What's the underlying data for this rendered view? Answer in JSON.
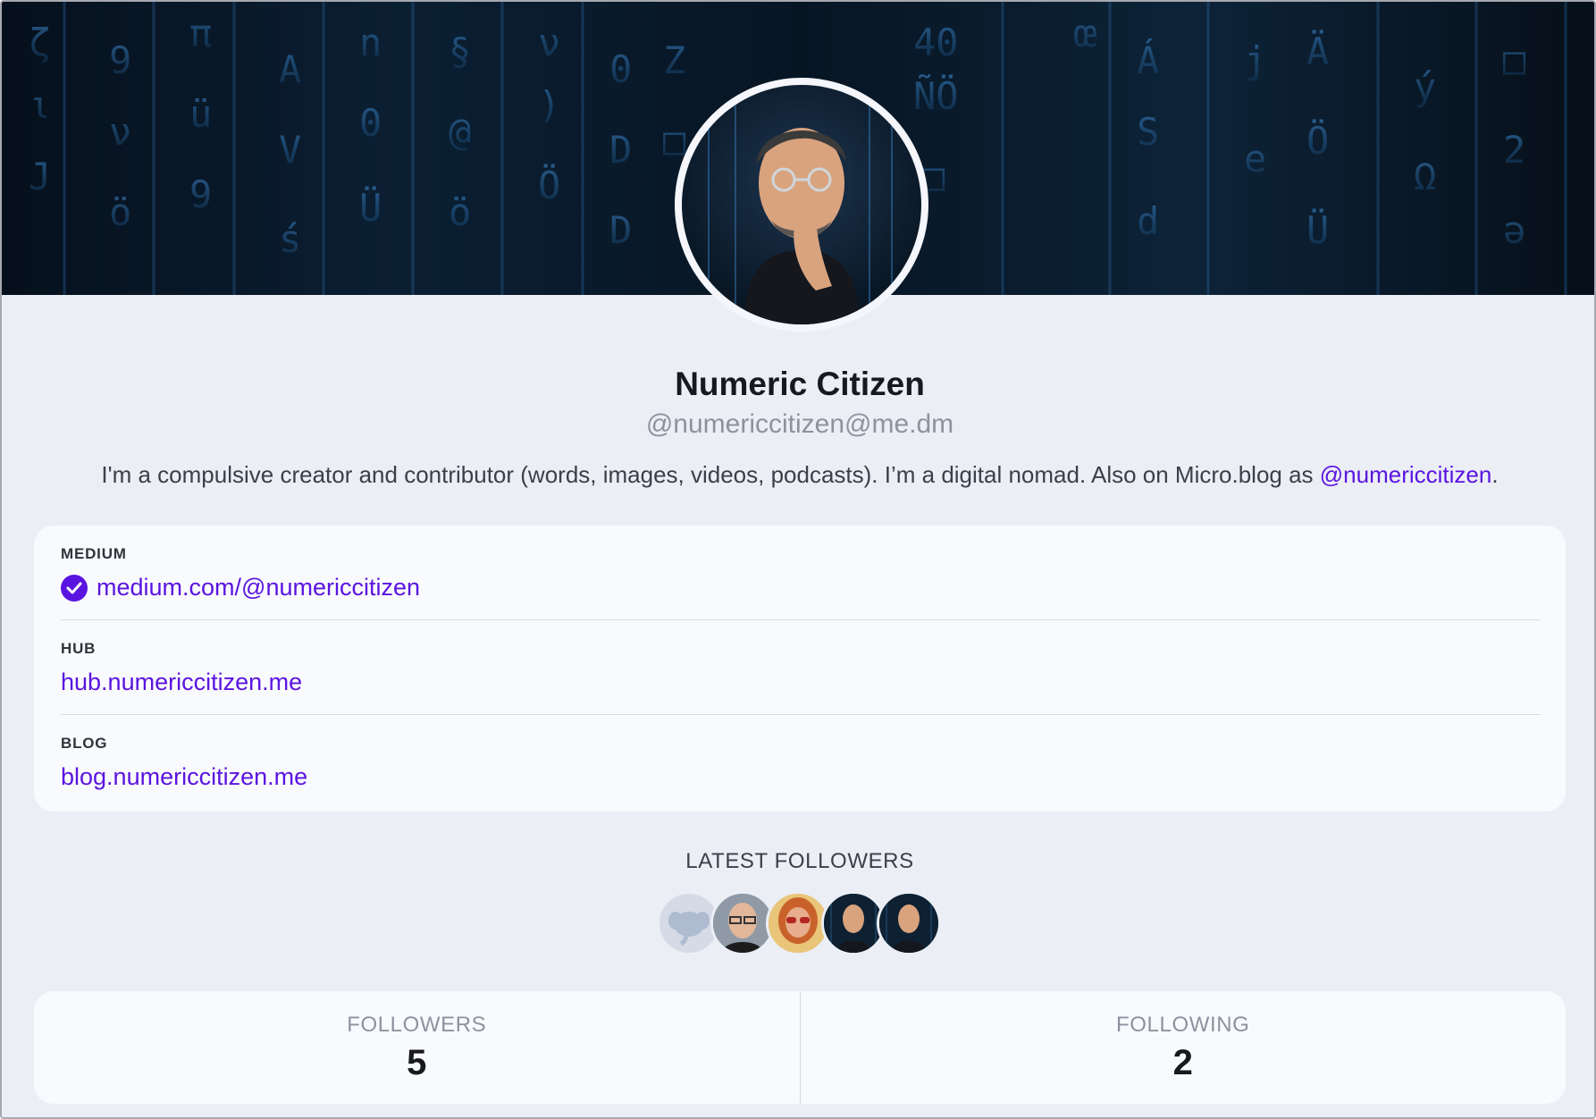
{
  "profile": {
    "display_name": "Numeric Citizen",
    "handle": "@numericcitizen@me.dm",
    "bio_text": "I'm a compulsive creator and contributor (words, images, videos, podcasts). I’m a digital nomad. Also on Micro.blog as ",
    "bio_mention": "@numericcitizen",
    "bio_end": "."
  },
  "fields": [
    {
      "label": "MEDIUM",
      "value": "medium.com/@numericcitizen",
      "verified": true
    },
    {
      "label": "HUB",
      "value": "hub.numericcitizen.me",
      "verified": false
    },
    {
      "label": "BLOG",
      "value": "blog.numericcitizen.me",
      "verified": false
    }
  ],
  "latest_followers": {
    "title": "LATEST FOLLOWERS",
    "avatars": [
      "default-mastodon-avatar",
      "photo-man-glasses",
      "photo-woman-sunglasses",
      "illustration-numeric-citizen",
      "illustration-numeric-citizen"
    ]
  },
  "stats": {
    "followers_label": "FOLLOWERS",
    "followers_value": "5",
    "following_label": "FOLLOWING",
    "following_value": "2"
  },
  "colors": {
    "accent": "#5a14e0",
    "background": "#ebeef5",
    "card": "#f9fafd"
  }
}
